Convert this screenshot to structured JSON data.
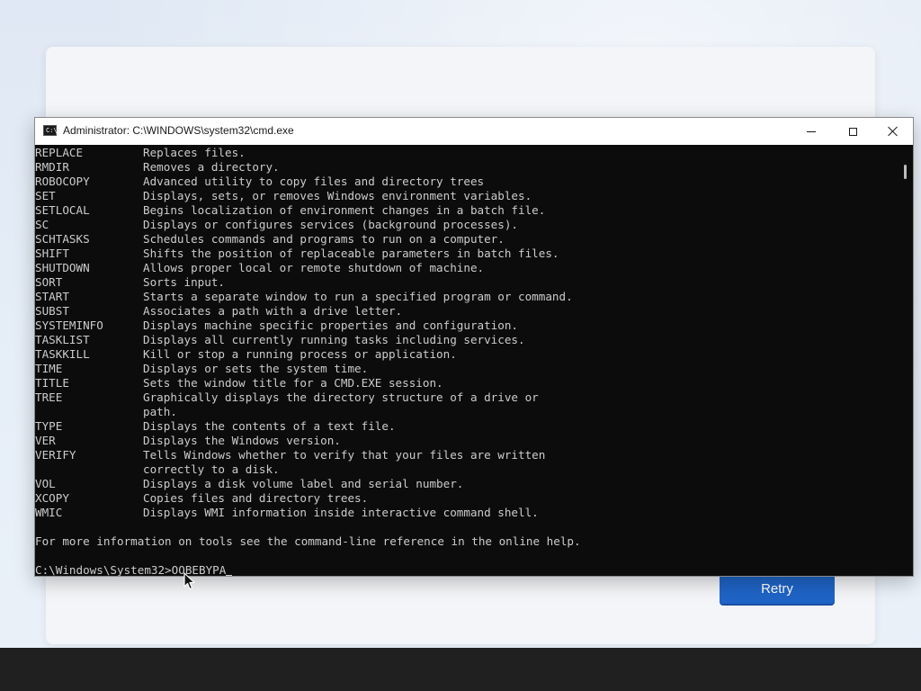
{
  "window": {
    "title": "Administrator: C:\\WINDOWS\\system32\\cmd.exe",
    "icon_text": "C:\\"
  },
  "commands": [
    {
      "name": "REPLACE",
      "desc": "Replaces files."
    },
    {
      "name": "RMDIR",
      "desc": "Removes a directory."
    },
    {
      "name": "ROBOCOPY",
      "desc": "Advanced utility to copy files and directory trees"
    },
    {
      "name": "SET",
      "desc": "Displays, sets, or removes Windows environment variables."
    },
    {
      "name": "SETLOCAL",
      "desc": "Begins localization of environment changes in a batch file."
    },
    {
      "name": "SC",
      "desc": "Displays or configures services (background processes)."
    },
    {
      "name": "SCHTASKS",
      "desc": "Schedules commands and programs to run on a computer."
    },
    {
      "name": "SHIFT",
      "desc": "Shifts the position of replaceable parameters in batch files."
    },
    {
      "name": "SHUTDOWN",
      "desc": "Allows proper local or remote shutdown of machine."
    },
    {
      "name": "SORT",
      "desc": "Sorts input."
    },
    {
      "name": "START",
      "desc": "Starts a separate window to run a specified program or command."
    },
    {
      "name": "SUBST",
      "desc": "Associates a path with a drive letter."
    },
    {
      "name": "SYSTEMINFO",
      "desc": "Displays machine specific properties and configuration."
    },
    {
      "name": "TASKLIST",
      "desc": "Displays all currently running tasks including services."
    },
    {
      "name": "TASKKILL",
      "desc": "Kill or stop a running process or application."
    },
    {
      "name": "TIME",
      "desc": "Displays or sets the system time."
    },
    {
      "name": "TITLE",
      "desc": "Sets the window title for a CMD.EXE session."
    },
    {
      "name": "TREE",
      "desc": "Graphically displays the directory structure of a drive or"
    },
    {
      "name": "",
      "desc": "path."
    },
    {
      "name": "TYPE",
      "desc": "Displays the contents of a text file."
    },
    {
      "name": "VER",
      "desc": "Displays the Windows version."
    },
    {
      "name": "VERIFY",
      "desc": "Tells Windows whether to verify that your files are written"
    },
    {
      "name": "",
      "desc": "correctly to a disk."
    },
    {
      "name": "VOL",
      "desc": "Displays a disk volume label and serial number."
    },
    {
      "name": "XCOPY",
      "desc": "Copies files and directory trees."
    },
    {
      "name": "WMIC",
      "desc": "Displays WMI information inside interactive command shell."
    }
  ],
  "help_note": "For more information on tools see the command-line reference in the online help.",
  "prompt": {
    "path": "C:\\Windows\\System32>",
    "input": "OOBEBYPA"
  },
  "oobe": {
    "retry_label": "Retry",
    "accent": "#1f64c6"
  },
  "colors": {
    "console_bg": "#0c0c0c",
    "console_fg": "#cccccc"
  }
}
